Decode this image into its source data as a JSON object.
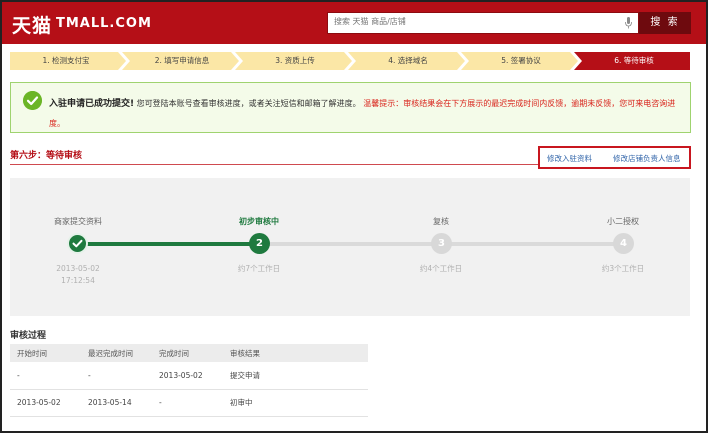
{
  "header": {
    "logo_cn": "天猫",
    "logo_en": "TMALL.COM",
    "search_placeholder": "搜索 天猫 商品/店铺",
    "search_button": "搜 索"
  },
  "steps": [
    {
      "label": "1. 检测支付宝",
      "active": false
    },
    {
      "label": "2. 填写申请信息",
      "active": false
    },
    {
      "label": "3. 资质上传",
      "active": false
    },
    {
      "label": "4. 选择域名",
      "active": false
    },
    {
      "label": "5. 签署协议",
      "active": false
    },
    {
      "label": "6. 等待审核",
      "active": true
    }
  ],
  "notice": {
    "title": "入驻申请已成功提交!",
    "body": "您可登陆本账号查看审核进度，或者关注短信和邮箱了解进度。",
    "warning": "温馨提示：审核结果会在下方展示的最迟完成时间内反馈，逾期未反馈，您可来电咨询进度。"
  },
  "section": {
    "title": "第六步：等待审核",
    "link_modify_info": "修改入驻资料",
    "link_modify_owner": "修改店铺负责人信息"
  },
  "progress": [
    {
      "label": "商家提交资料",
      "node": "",
      "status": "done",
      "sub1": "2013-05-02",
      "sub2": "17:12:54"
    },
    {
      "label": "初步审核中",
      "node": "2",
      "status": "current",
      "sub1": "约7个工作日",
      "sub2": ""
    },
    {
      "label": "复核",
      "node": "3",
      "status": "todo",
      "sub1": "约4个工作日",
      "sub2": ""
    },
    {
      "label": "小二授权",
      "node": "4",
      "status": "todo",
      "sub1": "约3个工作日",
      "sub2": ""
    }
  ],
  "review": {
    "title": "审核过程",
    "headers": [
      "开始时间",
      "最迟完成时间",
      "完成时间",
      "审核结果"
    ],
    "rows": [
      [
        "-",
        "-",
        "2013-05-02",
        "提交申请"
      ],
      [
        "2013-05-02",
        "2013-05-14",
        "-",
        "初审中"
      ]
    ]
  },
  "colors": {
    "brand_red": "#b50f17",
    "step_yellow": "#fbe7a6",
    "success_green": "#1f7a3f",
    "notice_bg": "#f4fbe9",
    "warning_red": "#d9241c",
    "link_blue": "#3366aa"
  },
  "icons": {
    "success": "check-circle-icon",
    "mic": "microphone-icon",
    "done_node": "check-icon"
  }
}
